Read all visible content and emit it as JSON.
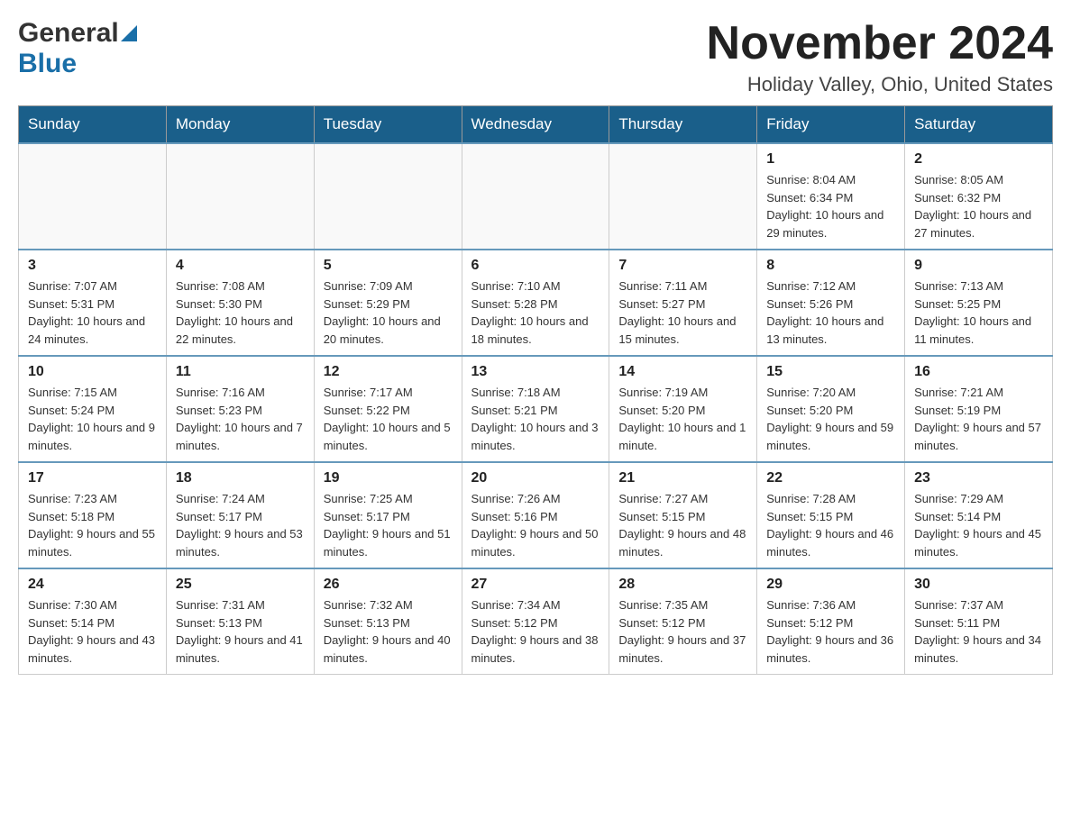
{
  "header": {
    "logo_general": "General",
    "logo_blue": "Blue",
    "month_title": "November 2024",
    "location": "Holiday Valley, Ohio, United States"
  },
  "calendar": {
    "days_of_week": [
      "Sunday",
      "Monday",
      "Tuesday",
      "Wednesday",
      "Thursday",
      "Friday",
      "Saturday"
    ],
    "weeks": [
      [
        {
          "day": "",
          "info": ""
        },
        {
          "day": "",
          "info": ""
        },
        {
          "day": "",
          "info": ""
        },
        {
          "day": "",
          "info": ""
        },
        {
          "day": "",
          "info": ""
        },
        {
          "day": "1",
          "info": "Sunrise: 8:04 AM\nSunset: 6:34 PM\nDaylight: 10 hours and 29 minutes."
        },
        {
          "day": "2",
          "info": "Sunrise: 8:05 AM\nSunset: 6:32 PM\nDaylight: 10 hours and 27 minutes."
        }
      ],
      [
        {
          "day": "3",
          "info": "Sunrise: 7:07 AM\nSunset: 5:31 PM\nDaylight: 10 hours and 24 minutes."
        },
        {
          "day": "4",
          "info": "Sunrise: 7:08 AM\nSunset: 5:30 PM\nDaylight: 10 hours and 22 minutes."
        },
        {
          "day": "5",
          "info": "Sunrise: 7:09 AM\nSunset: 5:29 PM\nDaylight: 10 hours and 20 minutes."
        },
        {
          "day": "6",
          "info": "Sunrise: 7:10 AM\nSunset: 5:28 PM\nDaylight: 10 hours and 18 minutes."
        },
        {
          "day": "7",
          "info": "Sunrise: 7:11 AM\nSunset: 5:27 PM\nDaylight: 10 hours and 15 minutes."
        },
        {
          "day": "8",
          "info": "Sunrise: 7:12 AM\nSunset: 5:26 PM\nDaylight: 10 hours and 13 minutes."
        },
        {
          "day": "9",
          "info": "Sunrise: 7:13 AM\nSunset: 5:25 PM\nDaylight: 10 hours and 11 minutes."
        }
      ],
      [
        {
          "day": "10",
          "info": "Sunrise: 7:15 AM\nSunset: 5:24 PM\nDaylight: 10 hours and 9 minutes."
        },
        {
          "day": "11",
          "info": "Sunrise: 7:16 AM\nSunset: 5:23 PM\nDaylight: 10 hours and 7 minutes."
        },
        {
          "day": "12",
          "info": "Sunrise: 7:17 AM\nSunset: 5:22 PM\nDaylight: 10 hours and 5 minutes."
        },
        {
          "day": "13",
          "info": "Sunrise: 7:18 AM\nSunset: 5:21 PM\nDaylight: 10 hours and 3 minutes."
        },
        {
          "day": "14",
          "info": "Sunrise: 7:19 AM\nSunset: 5:20 PM\nDaylight: 10 hours and 1 minute."
        },
        {
          "day": "15",
          "info": "Sunrise: 7:20 AM\nSunset: 5:20 PM\nDaylight: 9 hours and 59 minutes."
        },
        {
          "day": "16",
          "info": "Sunrise: 7:21 AM\nSunset: 5:19 PM\nDaylight: 9 hours and 57 minutes."
        }
      ],
      [
        {
          "day": "17",
          "info": "Sunrise: 7:23 AM\nSunset: 5:18 PM\nDaylight: 9 hours and 55 minutes."
        },
        {
          "day": "18",
          "info": "Sunrise: 7:24 AM\nSunset: 5:17 PM\nDaylight: 9 hours and 53 minutes."
        },
        {
          "day": "19",
          "info": "Sunrise: 7:25 AM\nSunset: 5:17 PM\nDaylight: 9 hours and 51 minutes."
        },
        {
          "day": "20",
          "info": "Sunrise: 7:26 AM\nSunset: 5:16 PM\nDaylight: 9 hours and 50 minutes."
        },
        {
          "day": "21",
          "info": "Sunrise: 7:27 AM\nSunset: 5:15 PM\nDaylight: 9 hours and 48 minutes."
        },
        {
          "day": "22",
          "info": "Sunrise: 7:28 AM\nSunset: 5:15 PM\nDaylight: 9 hours and 46 minutes."
        },
        {
          "day": "23",
          "info": "Sunrise: 7:29 AM\nSunset: 5:14 PM\nDaylight: 9 hours and 45 minutes."
        }
      ],
      [
        {
          "day": "24",
          "info": "Sunrise: 7:30 AM\nSunset: 5:14 PM\nDaylight: 9 hours and 43 minutes."
        },
        {
          "day": "25",
          "info": "Sunrise: 7:31 AM\nSunset: 5:13 PM\nDaylight: 9 hours and 41 minutes."
        },
        {
          "day": "26",
          "info": "Sunrise: 7:32 AM\nSunset: 5:13 PM\nDaylight: 9 hours and 40 minutes."
        },
        {
          "day": "27",
          "info": "Sunrise: 7:34 AM\nSunset: 5:12 PM\nDaylight: 9 hours and 38 minutes."
        },
        {
          "day": "28",
          "info": "Sunrise: 7:35 AM\nSunset: 5:12 PM\nDaylight: 9 hours and 37 minutes."
        },
        {
          "day": "29",
          "info": "Sunrise: 7:36 AM\nSunset: 5:12 PM\nDaylight: 9 hours and 36 minutes."
        },
        {
          "day": "30",
          "info": "Sunrise: 7:37 AM\nSunset: 5:11 PM\nDaylight: 9 hours and 34 minutes."
        }
      ]
    ]
  }
}
